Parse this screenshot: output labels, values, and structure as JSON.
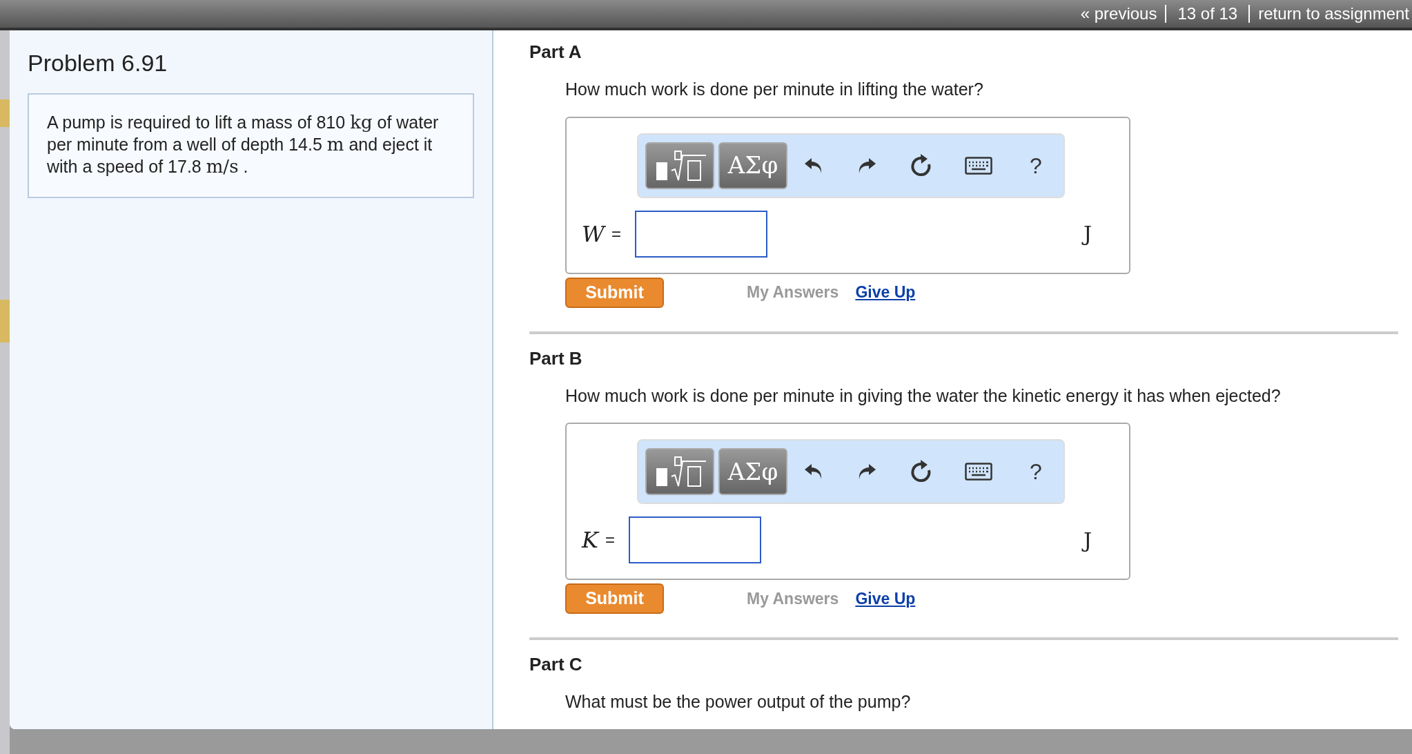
{
  "nav": {
    "previous": "« previous",
    "position": "13 of 13",
    "return": "return to assignment"
  },
  "problem": {
    "title": "Problem 6.91",
    "statement": [
      {
        "kind": "text",
        "text": "A pump is required to lift a mass of 810 "
      },
      {
        "kind": "math",
        "text": "kg"
      },
      {
        "kind": "text",
        "text": " of water per minute from a well of depth 14.5 "
      },
      {
        "kind": "math",
        "text": "m"
      },
      {
        "kind": "text",
        "text": " and eject it with a speed of 17.8 "
      },
      {
        "kind": "math",
        "text": "m/s"
      },
      {
        "kind": "text",
        "text": " ."
      }
    ]
  },
  "parts": [
    {
      "title": "Part A",
      "question": "How much work is done per minute in lifting the water?",
      "answer": {
        "variable": "W",
        "equals": "=",
        "unit": "J",
        "toolbar": {
          "symbols": "ΑΣφ",
          "help": "?"
        }
      },
      "submit": "Submit",
      "my_answers": "My Answers",
      "give_up": "Give Up"
    },
    {
      "title": "Part B",
      "question": "How much work is done per minute in giving the water the kinetic energy it has when ejected?",
      "answer": {
        "variable": "K",
        "equals": "=",
        "unit": "J",
        "toolbar": {
          "symbols": "ΑΣφ",
          "help": "?"
        }
      },
      "submit": "Submit",
      "my_answers": "My Answers",
      "give_up": "Give Up"
    },
    {
      "title": "Part C",
      "question": "What must be the power output of the pump?"
    }
  ]
}
